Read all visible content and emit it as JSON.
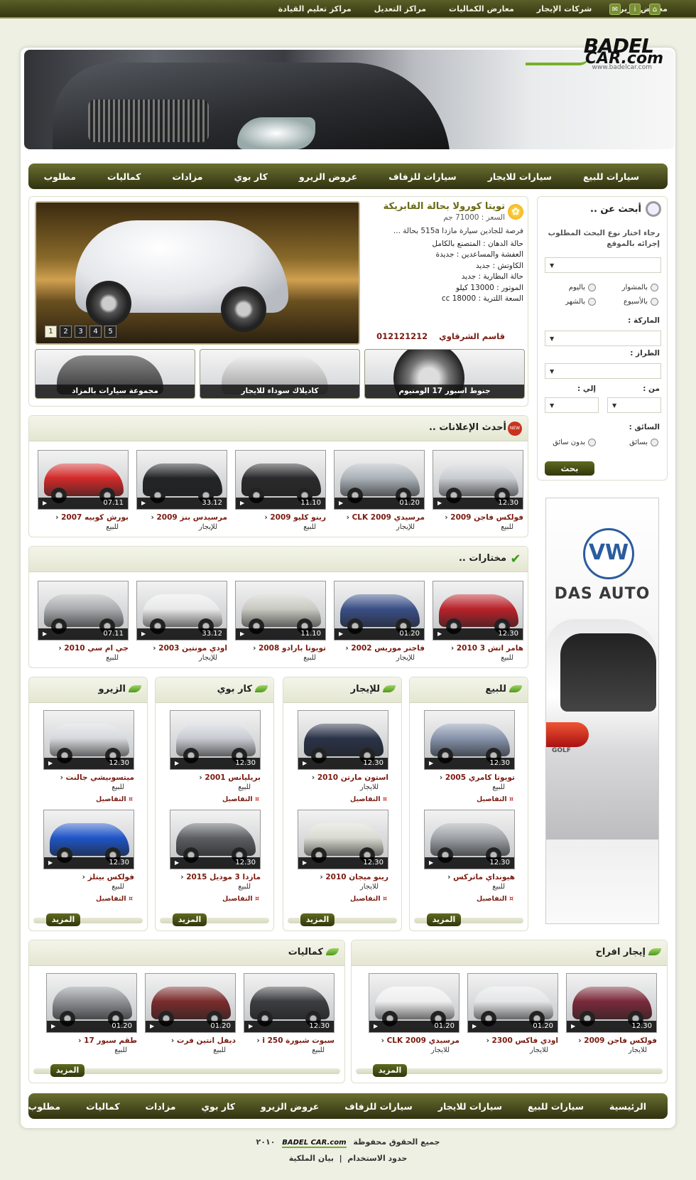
{
  "topbar": {
    "links": [
      "معارض الزيرو",
      "شركات الإيجار",
      "معارض الكماليات",
      "مراكز التعديل",
      "مراكز تعليم القيادة"
    ],
    "icons": [
      "home-icon",
      "info-icon",
      "mail-icon"
    ]
  },
  "logo": {
    "line1": "BADEL",
    "line2": "CAR.com",
    "url": "www.badelcar.com"
  },
  "nav": [
    "سيارات للبيع",
    "سيارات للايجار",
    "سيارات للزفاف",
    "عروض الزيرو",
    "كار بوي",
    "مزادات",
    "كماليات",
    "مطلوب"
  ],
  "footer_nav": [
    "الرئيسية",
    "سيارات للبيع",
    "سيارات للايجار",
    "سيارات للزفاف",
    "عروض الزيرو",
    "كار بوي",
    "مزادات",
    "كماليات",
    "مطلوب"
  ],
  "featured": {
    "title": "تويتا كورولا بحالة الفابريكة",
    "price": "السعر : 71000 جم",
    "desc": "فرصة للجادين سيارة مازدا 515a بحالة ...",
    "specs": [
      "حالة الدهان : المتصنع بالكامل",
      "العفشة والمساعدين : جديدة",
      "الكاوتش : جديد",
      "حالة البطارية : جديد",
      "الموتور : 13000 كيلو",
      "السعة اللترية : 18000 cc"
    ],
    "owner": "قاسم الشرقاوي",
    "phone": "012121212",
    "pages": [
      "1",
      "2",
      "3",
      "4",
      "5"
    ]
  },
  "promos": [
    "جنوط اسبور 17 الومنيوم",
    "كاديلاك سوداء للايجار",
    "مجموعة سيارات بالمزاد"
  ],
  "search": {
    "title": "أبحث عن ..",
    "hint": "رجاء اختار نوع البحث المطلوب إجرائه بالموقع",
    "r1": "بالمشوار",
    "r2": "باليوم",
    "r3": "بالأسبوع",
    "r4": "بالشهر",
    "brand": "الماركة :",
    "model": "الطراز :",
    "from": "من :",
    "to": "إلي :",
    "driver": "السائق :",
    "with_driver": "بسائق",
    "without_driver": "بدون سائق",
    "button": "بحث"
  },
  "latest": {
    "title": "أحدث الإعلانات ..",
    "items": [
      {
        "name": "فولكس فاجن 2009",
        "type": "للبيع",
        "time": "12.30",
        "color": "#c9ccd1"
      },
      {
        "name": "مرسيدي CLK 2009",
        "type": "للإيجار",
        "time": "01.20",
        "color": "#aab1b8"
      },
      {
        "name": "رينو كليو 2009",
        "type": "للبيع",
        "time": "11.10",
        "color": "#2a2a2c"
      },
      {
        "name": "مرسيدس بنز 2009",
        "type": "للإيجار",
        "time": "33.12",
        "color": "#222426"
      },
      {
        "name": "بورش كوبيه 2007",
        "type": "للبيع",
        "time": "07.11",
        "color": "#d22a2a"
      }
    ]
  },
  "picks": {
    "title": "مختارات ..",
    "items": [
      {
        "name": "هامر اتش 3 2010",
        "type": "للبيع",
        "time": "12.30",
        "color": "#b8222a"
      },
      {
        "name": "فاجنر موريس 2002",
        "type": "للإيجار",
        "time": "01.20",
        "color": "#3a4f86"
      },
      {
        "name": "تويوتا بارادو 2008",
        "type": "للبيع",
        "time": "11.10",
        "color": "#c9c9c2"
      },
      {
        "name": "اودي مونتين 2003",
        "type": "للإيجار",
        "time": "33.12",
        "color": "#e9e9ea"
      },
      {
        "name": "جي ام سي 2010",
        "type": "للبيع",
        "time": "07.11",
        "color": "#a9abae"
      }
    ]
  },
  "cols": [
    {
      "title": "للبيع",
      "items": [
        {
          "name": "تويوتا كامري 2005",
          "type": "للبيع",
          "time": "12.30",
          "color": "#8592aa"
        },
        {
          "name": "هيونداي ماتركس",
          "type": "للبيع",
          "time": "12.30",
          "color": "#9ea2a7"
        }
      ]
    },
    {
      "title": "للإيجار",
      "items": [
        {
          "name": "استون مارتن 2010",
          "type": "للايجار",
          "time": "12.30",
          "color": "#2a3348"
        },
        {
          "name": "رينو ميجان 2010",
          "type": "للايجار",
          "time": "12.30",
          "color": "#d9dbd2"
        }
      ]
    },
    {
      "title": "كار بوي",
      "items": [
        {
          "name": "بريليانس 2001",
          "type": "للبيع",
          "time": "12.30",
          "color": "#c8ccd2"
        },
        {
          "name": "مازدا 3 موديل 2015",
          "type": "للبيع",
          "time": "12.30",
          "color": "#5c5f63"
        }
      ]
    },
    {
      "title": "الزيرو",
      "items": [
        {
          "name": "ميتسوبيشي جالنت",
          "type": "للبيع",
          "time": "12.30",
          "color": "#d6d8dc"
        },
        {
          "name": "فولكس بيتلز",
          "type": "للبيع",
          "time": "12.30",
          "color": "#1f55c6"
        }
      ]
    }
  ],
  "details": "التفاصيل",
  "more": "المزيد",
  "wedding": {
    "title": "إيجار افراح",
    "items": [
      {
        "name": "فولكس فاجن 2009",
        "type": "للايجار",
        "time": "12.30",
        "color": "#7a2a3a"
      },
      {
        "name": "اودي فاكس 2300",
        "type": "للايجار",
        "time": "01.20",
        "color": "#e4e5e7"
      },
      {
        "name": "مرسيدي CLK 2009",
        "type": "للايجار",
        "time": "01.20",
        "color": "#eeeeef"
      }
    ]
  },
  "accessories": {
    "title": "كماليات",
    "items": [
      {
        "name": "سبوت شبورة 250 i",
        "type": "للبيع",
        "time": "12.30",
        "color": "#3c3d40"
      },
      {
        "name": "ديفل انتين فرت",
        "type": "للبيع",
        "time": "01.20",
        "color": "#7a2c2c"
      },
      {
        "name": "طقم سبور 17",
        "type": "للبيع",
        "time": "01.20",
        "color": "#8d8f93"
      }
    ]
  },
  "ad": {
    "brand": "VW",
    "slogan": "DAS AUTO",
    "badge": "GOLF"
  },
  "copyright": {
    "text": "جميع الحقوق محفوظة",
    "year": "٢٠١٠",
    "terms": "حدود الاستخدام",
    "privacy": "بيان الملكية"
  }
}
